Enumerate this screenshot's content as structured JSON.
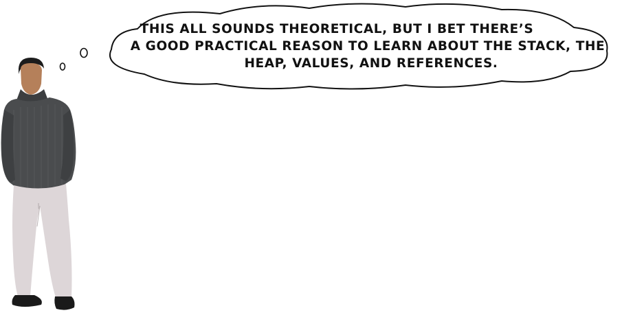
{
  "thought_bubble": {
    "lines": [
      "THIS ALL SOUNDS THEORETICAL, BUT I BET THERE’S",
      "A GOOD PRACTICAL REASON TO LEARN ABOUT THE STACK, THE",
      "HEAP, VALUES, AND REFERENCES."
    ]
  },
  "colors": {
    "sweater": "#4a4c4e",
    "pants": "#ddd6d8",
    "skin": "#b5805a",
    "hair": "#1c1c1c",
    "shoes": "#1a1a1a",
    "outline": "#111111"
  }
}
